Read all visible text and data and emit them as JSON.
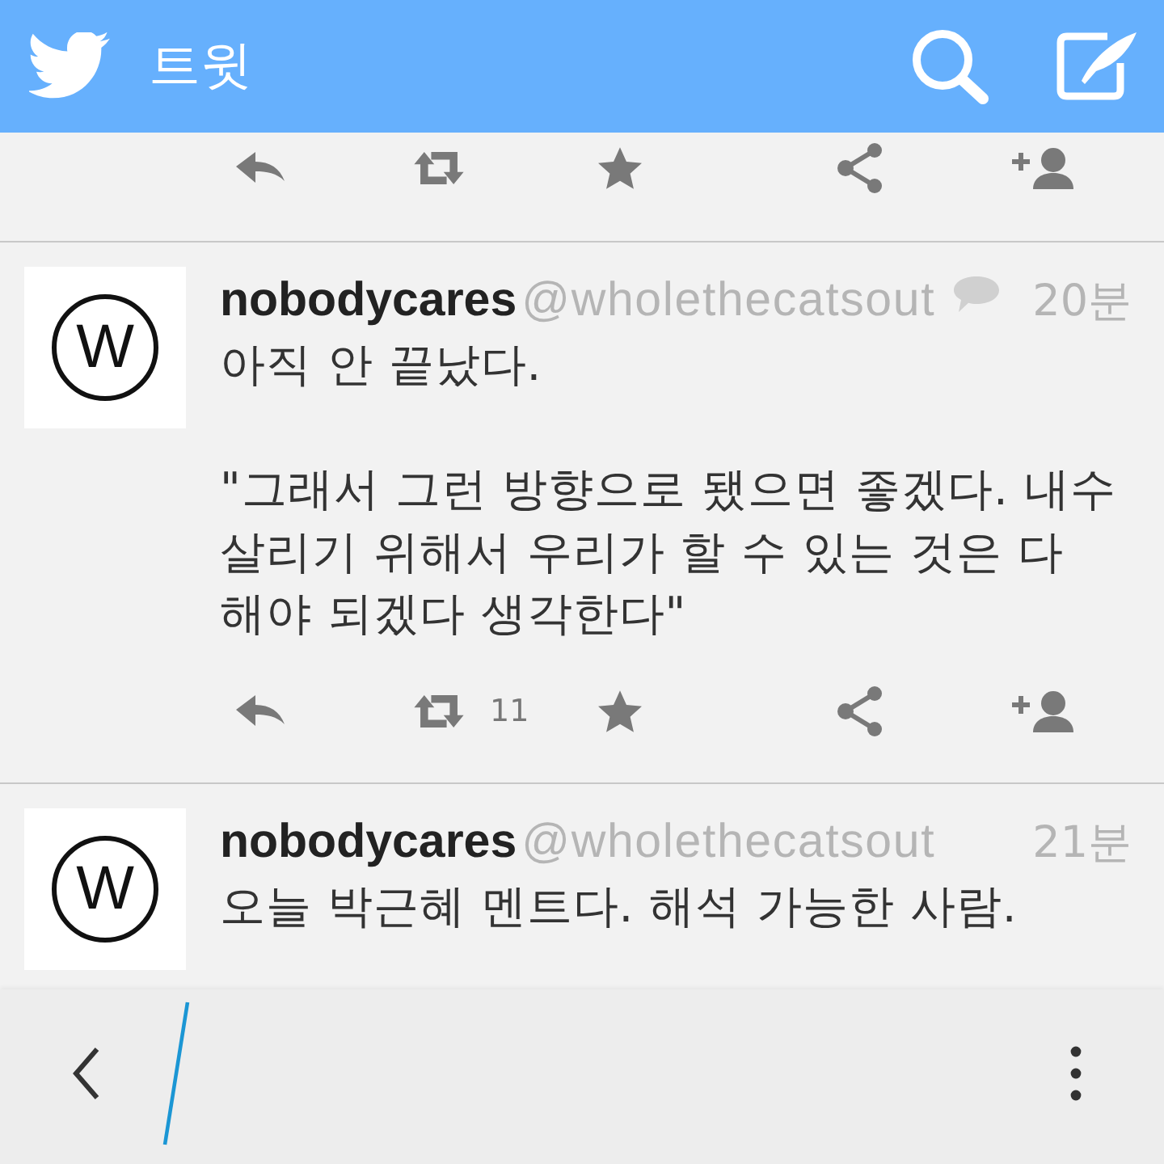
{
  "header": {
    "title": "트윗"
  },
  "tweets": [
    {
      "kind": "actions_only"
    },
    {
      "kind": "full",
      "avatar_letter": "W",
      "name": "nobodycares",
      "handle": "@wholethecatsout",
      "in_conversation": true,
      "time": "20분",
      "paragraphs": [
        [
          "아직 안 끝났다."
        ],
        [
          "\"그래서 그런 방향으로 됐으면 좋겠다. 내수",
          "살리기 위해서 우리가 할 수 있는 것은 다",
          "해야 되겠다 생각한다\""
        ]
      ],
      "retweet_count": "11"
    },
    {
      "kind": "cut_off",
      "avatar_letter": "W",
      "name": "nobodycares",
      "handle": "@wholethecatsout",
      "in_conversation": false,
      "time": "21분",
      "paragraphs": [
        [
          "오늘 박근혜 멘트다. 해석 가능한 사람."
        ]
      ]
    }
  ]
}
